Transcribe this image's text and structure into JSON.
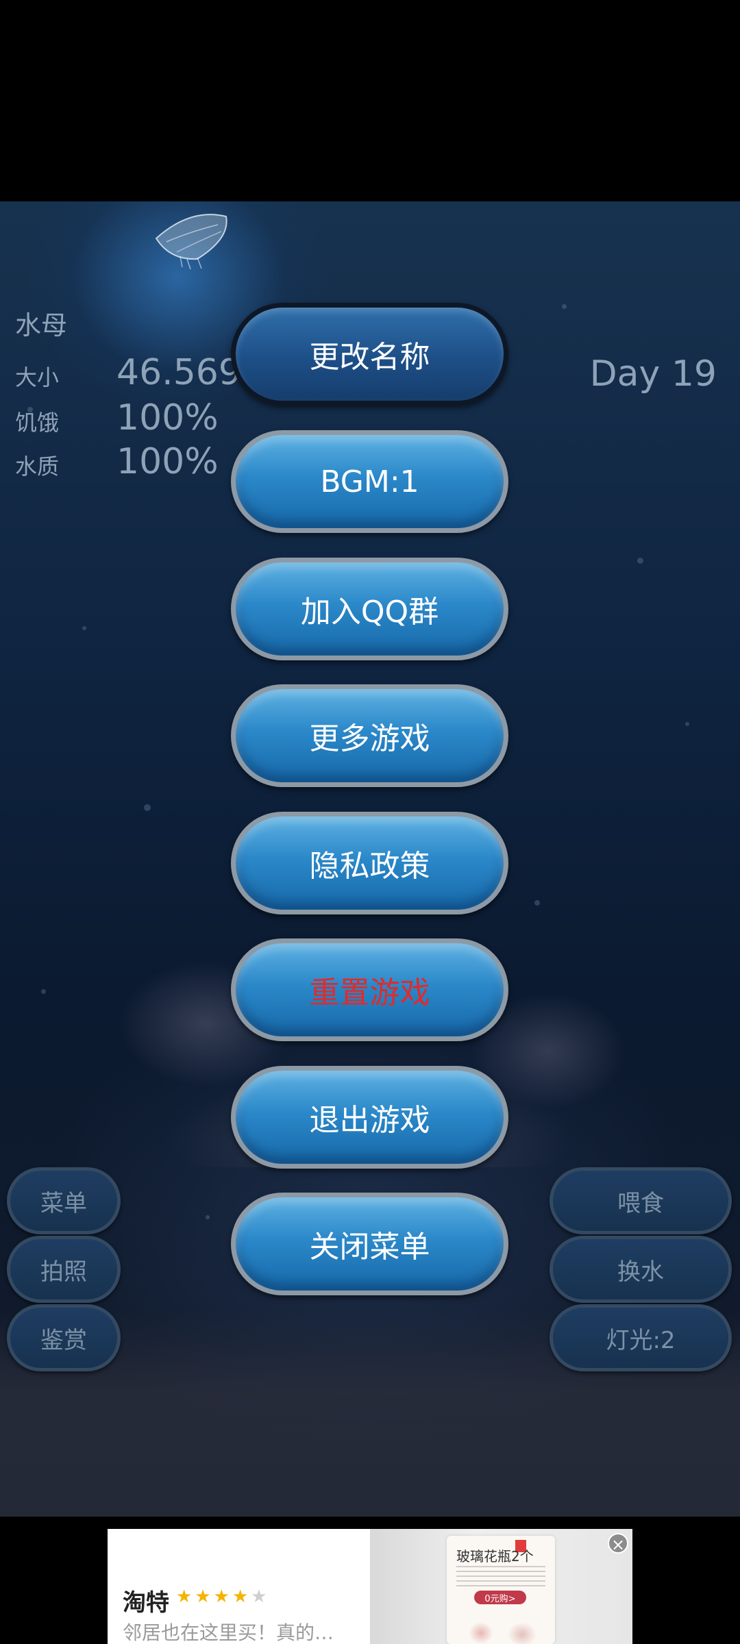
{
  "stats": {
    "name": "水母",
    "size_label": "大小",
    "size_value": "46.569599mm",
    "hunger_label": "饥饿",
    "hunger_value": "100%",
    "water_label": "水质",
    "water_value": "100%",
    "day": "Day 19"
  },
  "menu": [
    {
      "label": "更改名称"
    },
    {
      "label": "BGM:1"
    },
    {
      "label": "加入QQ群"
    },
    {
      "label": "更多游戏"
    },
    {
      "label": "隐私政策"
    },
    {
      "label": "重置游戏"
    },
    {
      "label": "退出游戏"
    },
    {
      "label": "关闭菜单"
    }
  ],
  "left_buttons": [
    {
      "label": "菜单"
    },
    {
      "label": "拍照"
    },
    {
      "label": "鉴赏"
    }
  ],
  "right_buttons": [
    {
      "label": "喂食"
    },
    {
      "label": "换水"
    },
    {
      "label": "灯光:2"
    }
  ],
  "ad": {
    "brand": "淘特",
    "rating": 4,
    "description": "邻居也在这里买！真的…",
    "image_title": "玻璃花瓶2个",
    "image_pill": "0元购>",
    "close_icon": "close-icon"
  },
  "colors": {
    "button_blue": "#2b88c9",
    "danger_text": "#e22a2a",
    "stat_text": "#8fa3b8"
  }
}
